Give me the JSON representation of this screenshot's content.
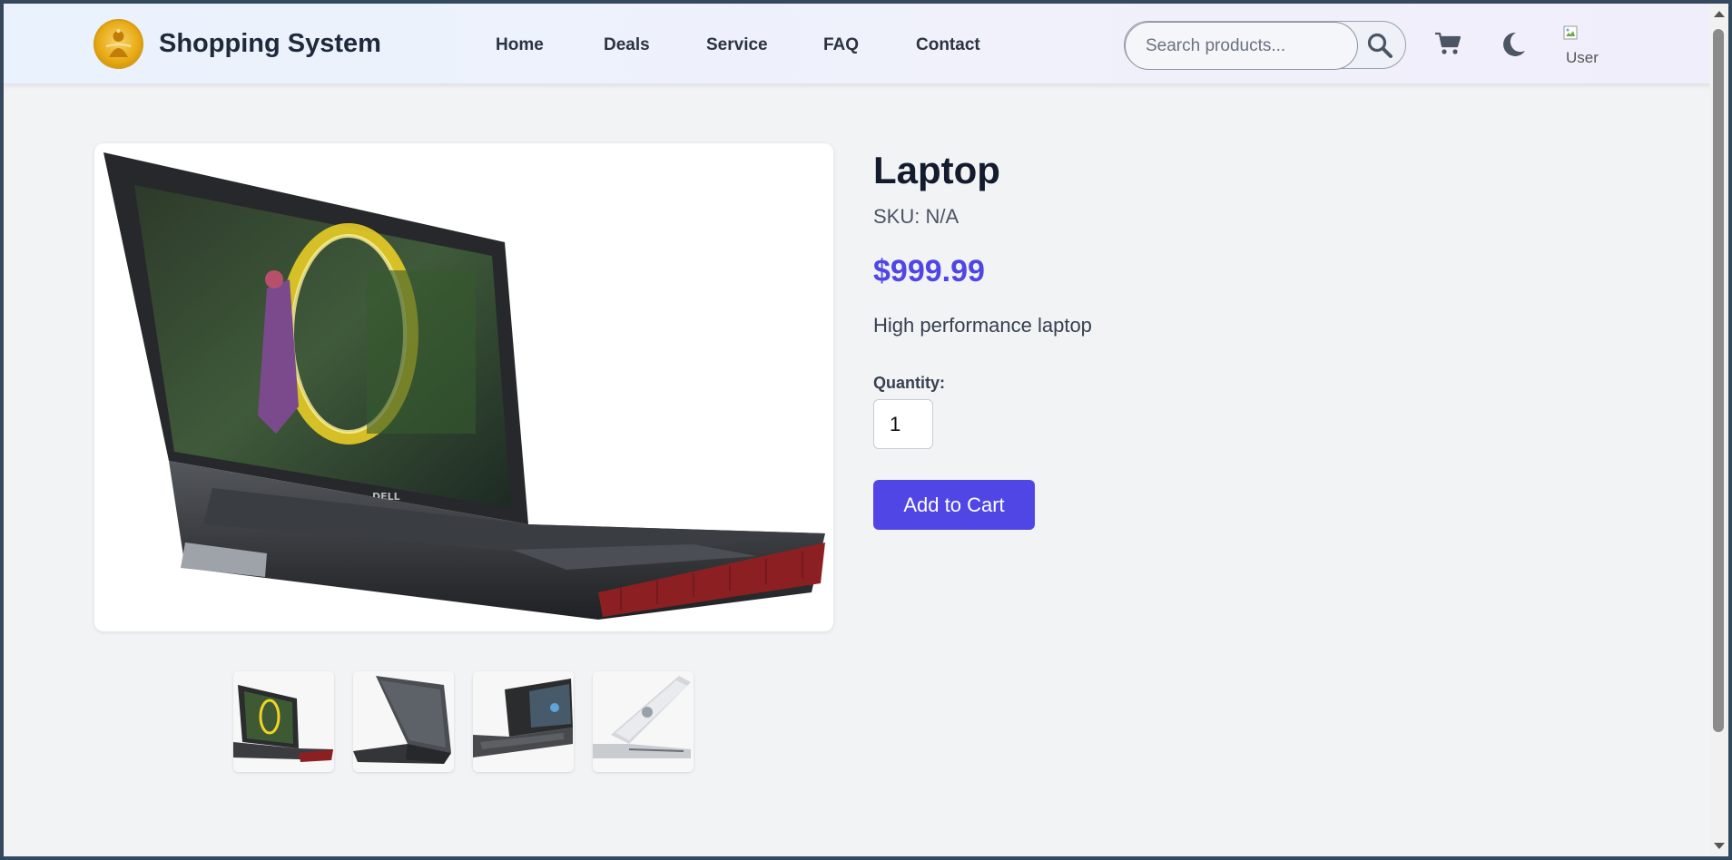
{
  "header": {
    "brand": "Shopping System",
    "nav": [
      "Home",
      "Deals",
      "Service",
      "FAQ",
      "Contact"
    ],
    "search": {
      "placeholder": "Search products...",
      "value": ""
    },
    "icons": [
      "search-icon",
      "cart-icon",
      "moon-icon",
      "user-avatar"
    ],
    "avatar_alt": "User"
  },
  "product": {
    "title": "Laptop",
    "sku": "SKU: N/A",
    "price": "$999.99",
    "description": "High performance laptop",
    "quantity_label": "Quantity:",
    "quantity_value": "1",
    "add_button": "Add to Cart",
    "thumbnails": [
      "laptop-front",
      "laptop-back",
      "laptop-side",
      "laptop-white"
    ],
    "screen_logo": "DELL"
  },
  "colors": {
    "accent": "#4f46e5",
    "page_bg": "#f2f3f5",
    "text_dark": "#141b2d"
  }
}
